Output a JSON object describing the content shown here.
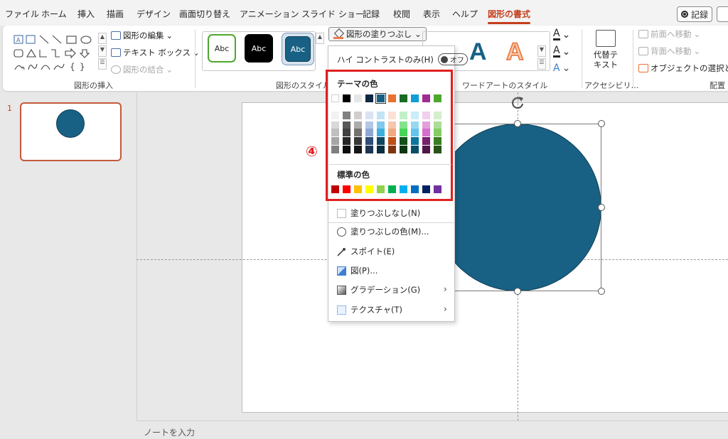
{
  "menu": {
    "tabs": [
      "ファイル",
      "ホーム",
      "挿入",
      "描画",
      "デザイン",
      "画面切り替え",
      "アニメーション",
      "スライド ショー",
      "記録",
      "校閲",
      "表示",
      "ヘルプ",
      "図形の書式"
    ],
    "active_tab": "図形の書式",
    "record_label": "記録"
  },
  "ribbon": {
    "insert_shapes": {
      "edit_shape": "図形の編集",
      "text_box": "テキスト ボックス",
      "merge_shapes": "図形の結合",
      "group_label": "図形の挿入"
    },
    "shape_styles": {
      "preview_text": "Abc",
      "group_label": "図形のスタイル",
      "fill_button": "図形の塗りつぶし"
    },
    "wordart": {
      "letter": "A",
      "group_label": "ワードアートのスタイル"
    },
    "accessibility": {
      "alt_text": "代替テ\nキスト",
      "group_label": "アクセシビリ…"
    },
    "arrange": {
      "bring_forward": "前面へ移動",
      "send_backward": "背面へ移動",
      "selection_pane": "オブジェクトの選択と表示",
      "group_label": "配置"
    }
  },
  "slides": {
    "current_number": "1"
  },
  "notes_placeholder": "ノートを入力",
  "fill_dropdown": {
    "high_contrast_label": "ハイ コントラストのみ(H)",
    "high_contrast_state": "オフ",
    "theme_colors_title": "テーマの色",
    "standard_colors_title": "標準の色",
    "theme_colors": [
      "#ffffff",
      "#000000",
      "#e7e6e6",
      "#0e2841",
      "#156082",
      "#e97132",
      "#196b24",
      "#0f9ed5",
      "#a02b93",
      "#4ea72e"
    ],
    "selected_theme_index": 4,
    "theme_shades": [
      [
        "#f2f2f2",
        "#d9d9d9",
        "#bfbfbf",
        "#a6a6a6",
        "#808080"
      ],
      [
        "#808080",
        "#595959",
        "#404040",
        "#262626",
        "#0d0d0d"
      ],
      [
        "#d0cece",
        "#aeabab",
        "#757171",
        "#3a3838",
        "#171616"
      ],
      [
        "#dae3f3",
        "#b4c7e7",
        "#8fa7d4",
        "#2f4f7a",
        "#1f3554"
      ],
      [
        "#c0e4f5",
        "#80c9eb",
        "#3daee0",
        "#0f4761",
        "#0a2f40"
      ],
      [
        "#fbe2d5",
        "#f6c6ad",
        "#f1a983",
        "#c04f15",
        "#80350e"
      ],
      [
        "#c1f0c8",
        "#83e28e",
        "#47d459",
        "#124f1b",
        "#0c3512"
      ],
      [
        "#cbecf9",
        "#97d9f3",
        "#63c5ee",
        "#0b769f",
        "#074f6a"
      ],
      [
        "#f2cfee",
        "#e49edd",
        "#d86dcd",
        "#78206e",
        "#501549"
      ],
      [
        "#d5eecb",
        "#acdd96",
        "#84cc63",
        "#3a7d22",
        "#275317"
      ]
    ],
    "standard_colors": [
      "#c00000",
      "#ff0000",
      "#ffc000",
      "#ffff00",
      "#92d050",
      "#00b050",
      "#00b0f0",
      "#0070c0",
      "#002060",
      "#7030a0"
    ],
    "items": {
      "no_fill": "塗りつぶしなし(N)",
      "more_colors": "塗りつぶしの色(M)...",
      "eyedropper": "スポイト(E)",
      "picture": "図(P)...",
      "gradient": "グラデーション(G)",
      "texture": "テクスチャ(T)"
    }
  },
  "callout_label": "④",
  "shape_fill_color": "#186184"
}
